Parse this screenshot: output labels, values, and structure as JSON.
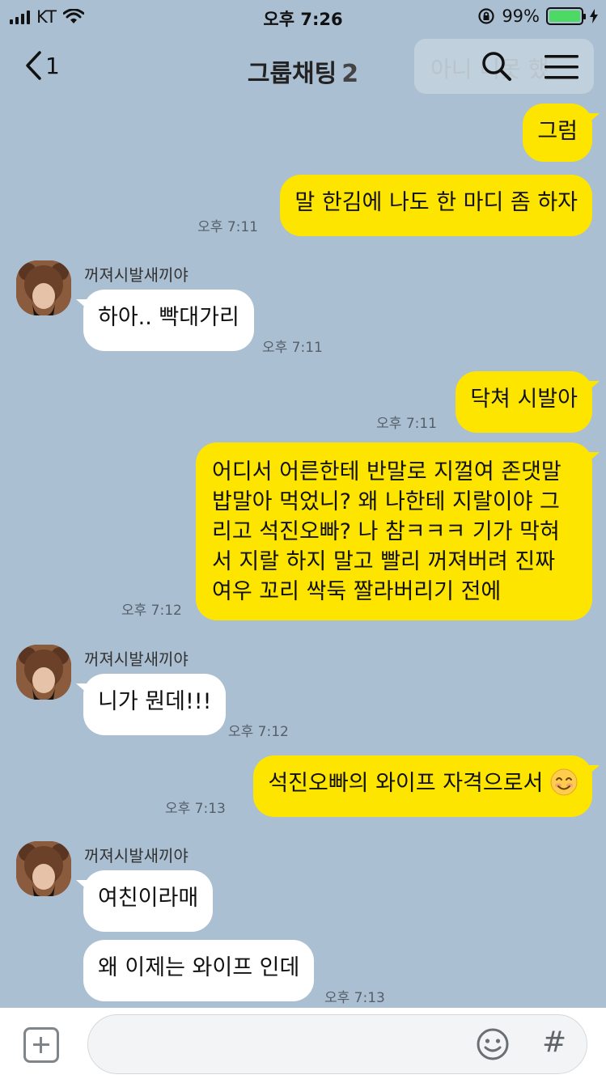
{
  "status_bar": {
    "carrier": "KT",
    "time": "오후 7:26",
    "battery_percent": "99%",
    "battery_level": 0.99
  },
  "header": {
    "back_count": "1",
    "title": "그룹채팅",
    "member_count": "2",
    "search_overlay_text": "아니 니못 했",
    "icons": [
      "chevron-left-icon",
      "search-icon",
      "menu-icon"
    ]
  },
  "messages": [
    {
      "sender": "me",
      "text": "그럼"
    },
    {
      "sender": "me",
      "text": "말 한김에 나도 한 마디 좀 하자",
      "time": "오후 7:11"
    },
    {
      "sender": "them",
      "name": "꺼져시발새끼야",
      "text": "하아.. 빡대가리",
      "time": "오후 7:11"
    },
    {
      "sender": "me",
      "text": "닥쳐 시발아",
      "time": "오후 7:11"
    },
    {
      "sender": "me",
      "lines": [
        "어디서 어른한테 반말로 지껄여 존댓말",
        "밥말아 먹었니? 왜 나한테 지랄이야 그",
        "리고 석진오빠? 나 참ㅋㅋㅋ 기가 막혀",
        "서 지랄 하지 말고 빨리 꺼져버려 진짜",
        "여우 꼬리 싹둑 짤라버리기 전에"
      ],
      "time": "오후 7:12"
    },
    {
      "sender": "them",
      "name": "꺼져시발새끼야",
      "text": "니가 뭔데!!!",
      "time": "오후 7:12"
    },
    {
      "sender": "me",
      "text": "석진오빠의 와이프 자격으로서",
      "emoji": "smiling-face-icon",
      "time": "오후 7:13"
    },
    {
      "sender": "them",
      "name": "꺼져시발새끼야",
      "text": "여친이라매"
    },
    {
      "sender": "them",
      "text": "왜 이제는 와이프 인데",
      "time": "오후 7:13"
    }
  ],
  "input_bar": {
    "icons": [
      "plus-icon",
      "emoji-icon",
      "hash-icon"
    ],
    "hash_glyph": "#"
  },
  "colors": {
    "background": "#abbfd2",
    "my_bubble": "#fee500",
    "their_bubble": "#ffffff",
    "battery_fill": "#4cd964"
  }
}
